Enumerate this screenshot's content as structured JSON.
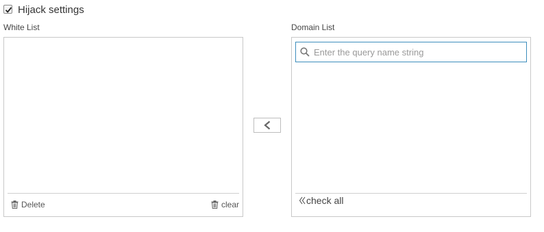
{
  "hijack": {
    "label": "Hijack settings",
    "checked": true
  },
  "white_list": {
    "label": "White List",
    "delete_label": "Delete",
    "clear_label": "clear",
    "delete_icon": "trash-icon",
    "clear_icon": "trash-icon"
  },
  "domain_list": {
    "label": "Domain List",
    "search_placeholder": "Enter the query name string",
    "search_value": "",
    "search_icon": "search-icon",
    "check_all_label": "check all",
    "check_all_icon": "double-left-chevron-icon"
  },
  "move_button": {
    "icon": "chevron-left-icon"
  },
  "colors": {
    "accent": "#3c8dbc",
    "border": "#c8c8c8",
    "text": "#333333"
  }
}
